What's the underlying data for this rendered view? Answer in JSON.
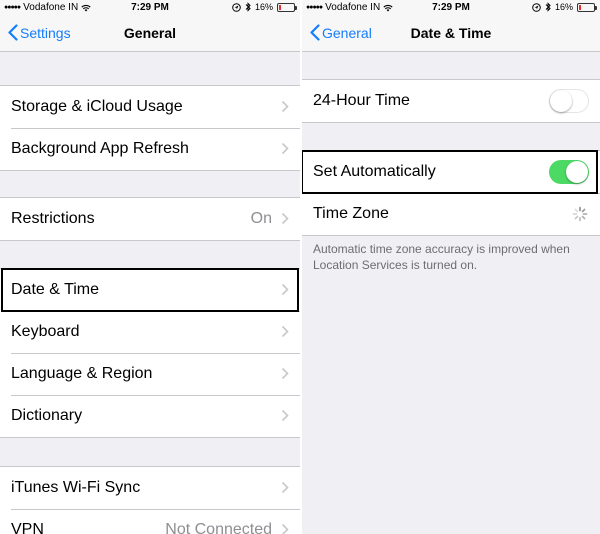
{
  "left": {
    "status": {
      "carrier": "Vodafone IN",
      "time": "7:29 PM",
      "battery": "16%",
      "battery_level": 0.16
    },
    "nav": {
      "back_label": "Settings",
      "title": "General"
    },
    "rows": {
      "storage": "Storage & iCloud Usage",
      "bg_refresh": "Background App Refresh",
      "restrictions": "Restrictions",
      "restrictions_value": "On",
      "date_time": "Date & Time",
      "keyboard": "Keyboard",
      "language": "Language & Region",
      "dictionary": "Dictionary",
      "itunes": "iTunes Wi-Fi Sync",
      "vpn": "VPN",
      "vpn_value": "Not Connected"
    }
  },
  "right": {
    "status": {
      "carrier": "Vodafone IN",
      "time": "7:29 PM",
      "battery": "16%",
      "battery_level": 0.16
    },
    "nav": {
      "back_label": "General",
      "title": "Date & Time"
    },
    "rows": {
      "hour24": "24-Hour Time",
      "hour24_on": false,
      "set_auto": "Set Automatically",
      "set_auto_on": true,
      "time_zone": "Time Zone"
    },
    "footnote": "Automatic time zone accuracy is improved when Location Services is turned on."
  },
  "colors": {
    "accent": "#147efb",
    "toggle_on": "#4cd964",
    "background": "#efeff4",
    "battery_low": "#e0322d"
  },
  "icons": [
    "signal-dots-icon",
    "wifi-icon",
    "location-icon",
    "bluetooth-icon",
    "battery-icon",
    "back-chevron-icon",
    "chevron-right-icon",
    "loading-spinner-icon"
  ]
}
